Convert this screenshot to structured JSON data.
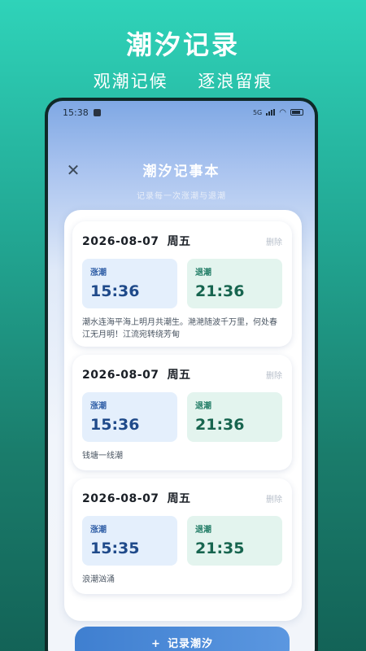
{
  "promo": {
    "title": "潮汐记录",
    "subtitle_left": "观潮记候",
    "subtitle_right": "逐浪留痕"
  },
  "status_bar": {
    "time": "15:38",
    "network_label": "5G"
  },
  "header": {
    "title": "潮汐记事本",
    "subtitle": "记录每一次涨潮与退潮"
  },
  "labels": {
    "delete": "删除",
    "rise": "涨潮",
    "fall": "退潮"
  },
  "records": [
    {
      "date": "2026-08-07",
      "weekday": "周五",
      "rise_time": "15:36",
      "fall_time": "21:36",
      "note": "潮水连海平海上明月共潮生。滟滟随波千万里，何处春江无月明！江流宛转绕芳甸"
    },
    {
      "date": "2026-08-07",
      "weekday": "周五",
      "rise_time": "15:36",
      "fall_time": "21:36",
      "note": "钱塘一线潮"
    },
    {
      "date": "2026-08-07",
      "weekday": "周五",
      "rise_time": "15:35",
      "fall_time": "21:35",
      "note": "浪潮汹涌"
    }
  ],
  "add_button": {
    "icon": "+",
    "label": "记录潮汐"
  },
  "colors": {
    "brand_green": "#22a894",
    "accent_blue": "#3f7fd0",
    "rise_bg": "#e4effc",
    "fall_bg": "#e3f4ee"
  }
}
